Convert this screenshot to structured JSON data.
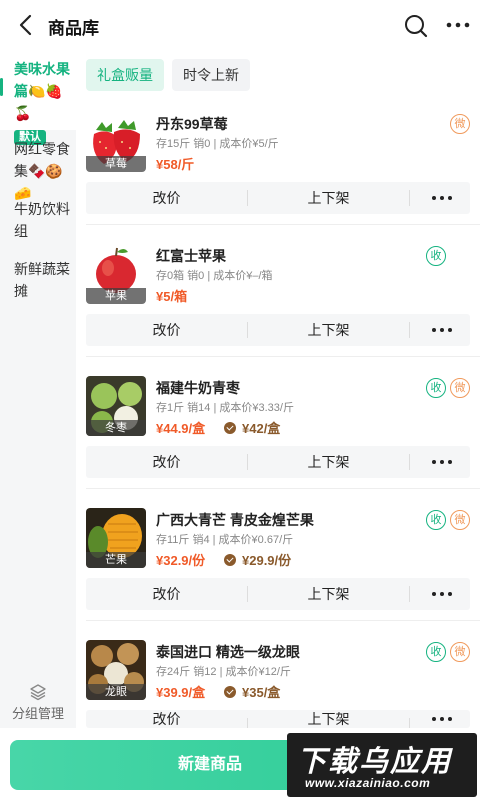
{
  "header": {
    "title": "商品库"
  },
  "sidebar": {
    "items": [
      {
        "label": "美味水果篇🍋🍓🍒",
        "badge": "默认"
      },
      {
        "label": "网红零食集🍫🍪🧀"
      },
      {
        "label": "牛奶饮料组"
      },
      {
        "label": "新鲜蔬菜摊"
      }
    ],
    "manage_label": "分组管理"
  },
  "tags": [
    "礼盒贩量",
    "时令上新"
  ],
  "actions": {
    "edit_price": "改价",
    "shelf": "上下架"
  },
  "products": [
    {
      "thumb_label": "草莓",
      "name": "丹东99草莓",
      "meta": "存15斤  销0 | 成本价¥5/斤",
      "price": "¥58/斤",
      "vip_price": "",
      "badges": [
        "微"
      ]
    },
    {
      "thumb_label": "苹果",
      "name": "红富士苹果",
      "meta": "存0箱  销0 | 成本价¥–/箱",
      "price": "¥5/箱",
      "vip_price": "",
      "badges": [
        "收"
      ]
    },
    {
      "thumb_label": "冬枣",
      "name": "福建牛奶青枣",
      "meta": "存1斤  销14 | 成本价¥3.33/斤",
      "price": "¥44.9/盒",
      "vip_price": "¥42/盒",
      "badges": [
        "收",
        "微"
      ]
    },
    {
      "thumb_label": "芒果",
      "name": "广西大青芒 青皮金煌芒果",
      "meta": "存11斤  销4 | 成本价¥0.67/斤",
      "price": "¥32.9/份",
      "vip_price": "¥29.9/份",
      "badges": [
        "收",
        "微"
      ]
    },
    {
      "thumb_label": "龙眼",
      "name": "泰国进口 精选一级龙眼",
      "meta": "存24斤  销12 | 成本价¥12/斤",
      "price": "¥39.9/盒",
      "vip_price": "¥35/盒",
      "badges": [
        "收",
        "微"
      ]
    }
  ],
  "bottom": {
    "new_product": "新建商品"
  },
  "watermark": {
    "big": "下载乌应用",
    "small": "www.xiazainiao.com"
  },
  "colors": {
    "accent": "#15b380",
    "price": "#f05a28",
    "vip": "#8a5a2c",
    "wei": "#f09a5c"
  },
  "icons": [
    "back-arrow-icon",
    "search-icon",
    "more-icon",
    "layers-icon",
    "vip-check-icon"
  ]
}
